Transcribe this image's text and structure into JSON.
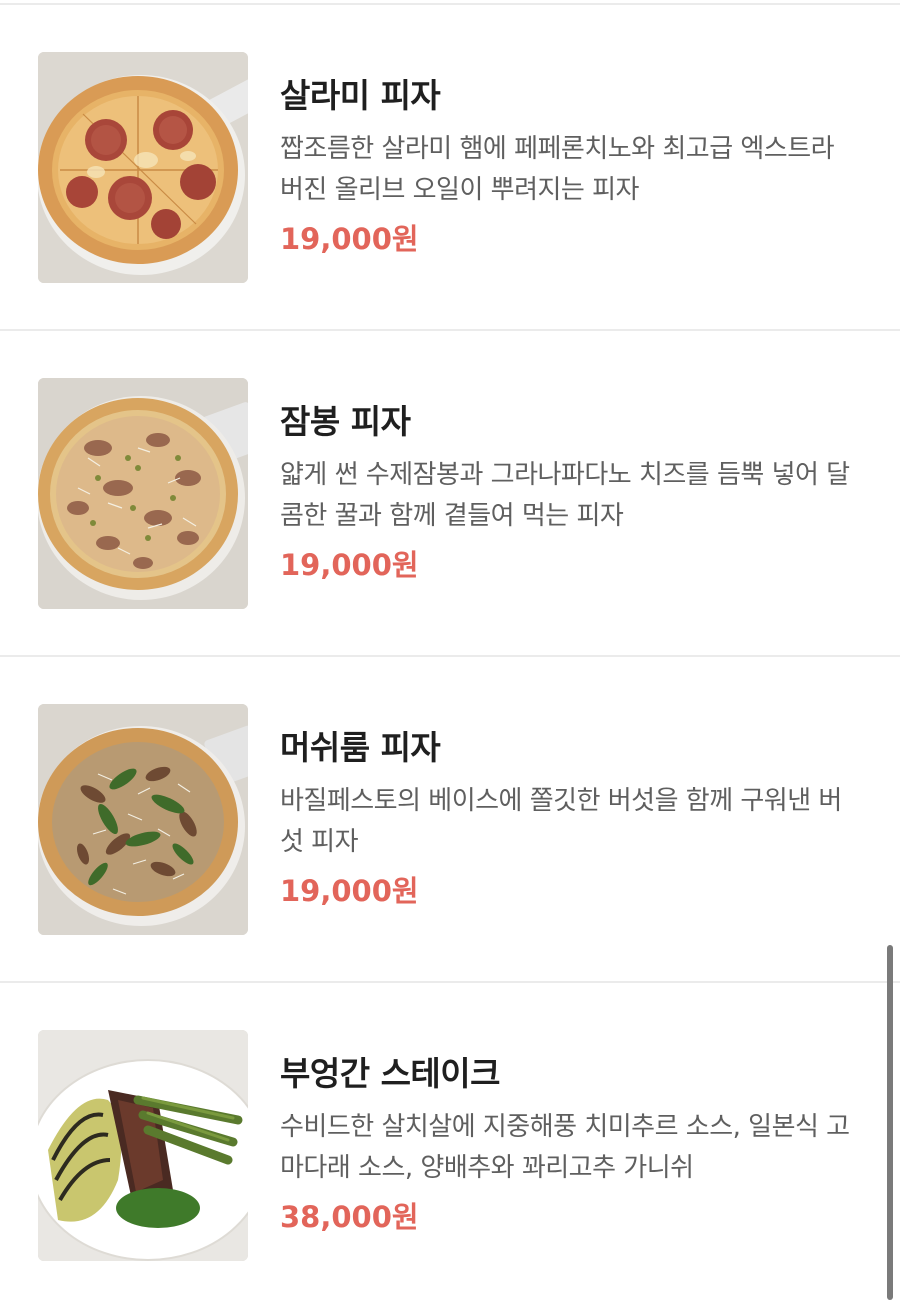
{
  "menu": {
    "items": [
      {
        "name": "살라미 피자",
        "description": "짭조름한 살라미 햄에 페페론치노와 최고급 엑스트라 버진 올리브 오일이 뿌려지는 피자",
        "price": "19,000원",
        "image_icon": "salami-pizza-image"
      },
      {
        "name": "잠봉 피자",
        "description": "얇게 썬 수제잠봉과 그라나파다노 치즈를 듬뿍 넣어 달콤한 꿀과 함께 곁들여 먹는 피자",
        "price": "19,000원",
        "image_icon": "jambon-pizza-image"
      },
      {
        "name": "머쉬룸 피자",
        "description": "바질페스토의 베이스에 쫄깃한 버섯을 함께 구워낸 버섯 피자",
        "price": "19,000원",
        "image_icon": "mushroom-pizza-image"
      },
      {
        "name": "부엉간 스테이크",
        "description": "수비드한 살치살에 지중해풍 치미추르 소스, 일본식 고마다래 소스, 양배추와 꽈리고추 가니쉬",
        "price": "38,000원",
        "image_icon": "steak-dish-image"
      }
    ]
  },
  "colors": {
    "price": "#e2655a",
    "name": "#1f1f1f",
    "description": "#5f5f5f",
    "divider": "#ebebeb"
  }
}
